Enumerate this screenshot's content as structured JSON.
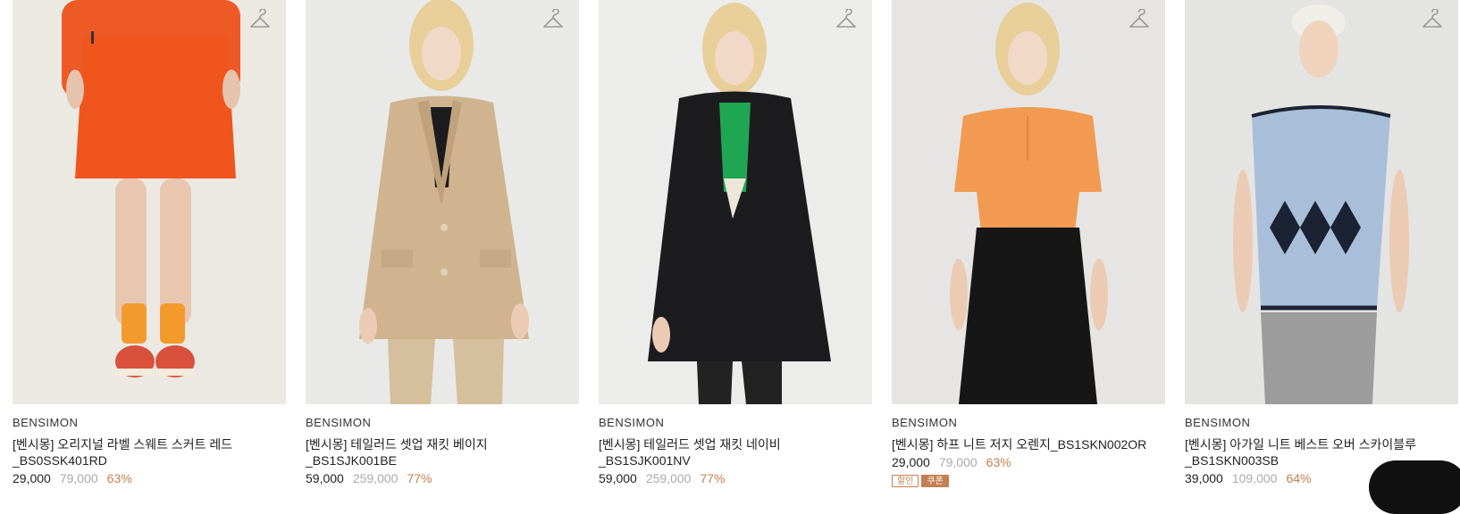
{
  "products": [
    {
      "brand": "BENSIMON",
      "name_line1": "[벤시몽] 오리지널 라벨 스웨트 스커트 레드",
      "name_line2": "_BS0SSK401RD",
      "sale_price": "29,000",
      "original_price": "79,000",
      "discount": "63%",
      "badges": []
    },
    {
      "brand": "BENSIMON",
      "name_line1": "[벤시몽] 테일러드 셋업 재킷 베이지",
      "name_line2": "_BS1SJK001BE",
      "sale_price": "59,000",
      "original_price": "259,000",
      "discount": "77%",
      "badges": []
    },
    {
      "brand": "BENSIMON",
      "name_line1": "[벤시몽] 테일러드 셋업 재킷 네이비",
      "name_line2": "_BS1SJK001NV",
      "sale_price": "59,000",
      "original_price": "259,000",
      "discount": "77%",
      "badges": []
    },
    {
      "brand": "BENSIMON",
      "name_line1": "[벤시몽] 하프 니트 저지 오렌지_BS1SKN002OR",
      "name_line2": "",
      "sale_price": "29,000",
      "original_price": "79,000",
      "discount": "63%",
      "badges": [
        "할인",
        "쿠폰"
      ]
    },
    {
      "brand": "BENSIMON",
      "name_line1": "[벤시몽] 아가일 니트 베스트 오버 스카이블루",
      "name_line2": "_BS1SKN003SB",
      "sale_price": "39,000",
      "original_price": "109,000",
      "discount": "64%",
      "badges": []
    }
  ],
  "colors": {
    "discount": "#c47f52",
    "original_price": "#aaaaaa",
    "hanger_icon": "#9a9a9a"
  },
  "icons": {
    "wishlist": "hanger-icon",
    "floating": "floating-action-button"
  }
}
